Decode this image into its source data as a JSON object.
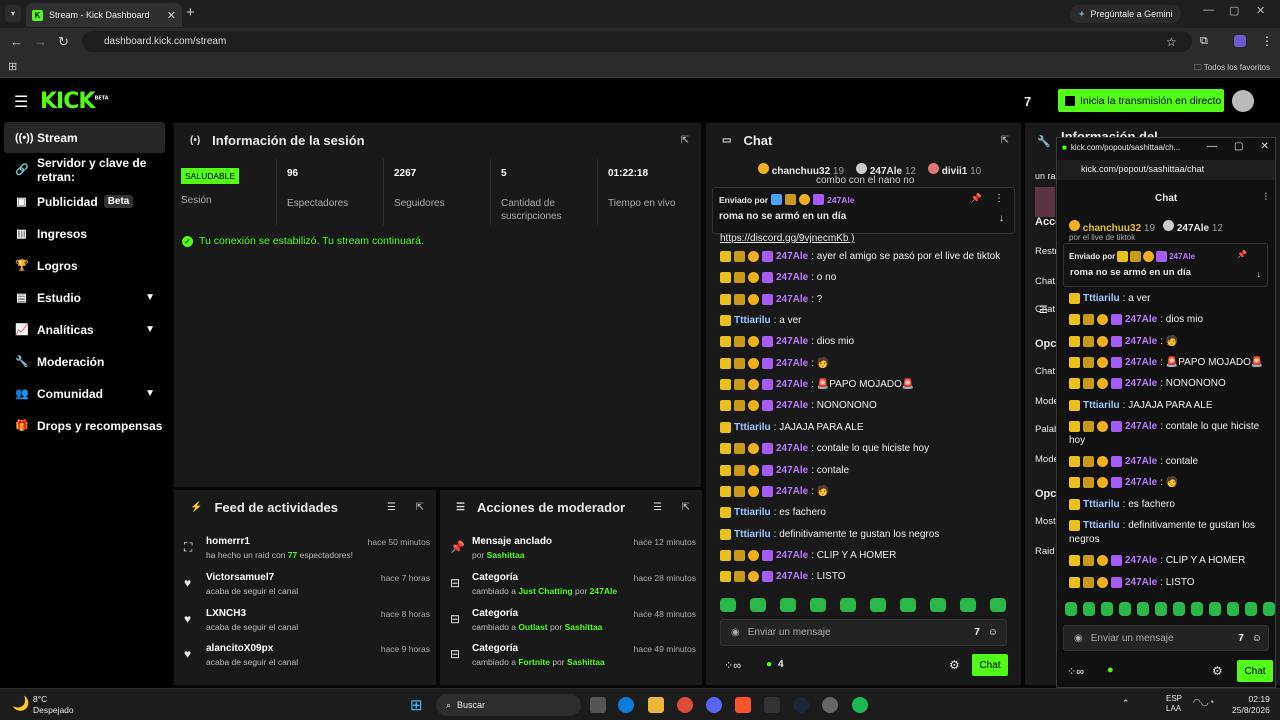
{
  "browser": {
    "tab_title": "Stream - Kick Dashboard",
    "url": "dashboard.kick.com/stream",
    "gemini": "Pregúntale a Gemini",
    "favorites": "Todos los favoritos"
  },
  "header": {
    "logo": "KICK",
    "logo_badge": "BETA",
    "go_live": "Inicia la transmisión en directo",
    "tv_icon": "7tv-icon"
  },
  "sidebar": {
    "items": [
      {
        "label": "Stream",
        "icon": "signal-icon"
      },
      {
        "label": "Servidor y clave de retran:",
        "icon": "link-icon"
      },
      {
        "label": "Publicidad",
        "badge": "Beta",
        "icon": "ad-icon"
      },
      {
        "label": "Ingresos",
        "icon": "chart-icon"
      },
      {
        "label": "Logros",
        "icon": "trophy-icon"
      },
      {
        "label": "Estudio",
        "icon": "studio-icon"
      },
      {
        "label": "Analíticas",
        "icon": "analytics-icon"
      },
      {
        "label": "Moderación",
        "icon": "wrench-icon"
      },
      {
        "label": "Comunidad",
        "icon": "community-icon"
      },
      {
        "label": "Drops y recompensas",
        "icon": "gift-icon"
      }
    ]
  },
  "session": {
    "title": "Información de la sesión",
    "health": "SALUDABLE",
    "health_label": "Sesión",
    "stats": [
      {
        "value": "96",
        "label": "Espectadores"
      },
      {
        "value": "2267",
        "label": "Seguidores"
      },
      {
        "value": "5",
        "label": "Cantidad de suscripciones"
      },
      {
        "value": "01:22:18",
        "label": "Tiempo en vivo"
      }
    ],
    "message": "Tu conexión se estabilizó. Tu stream continuará."
  },
  "feed": {
    "title": "Feed de actividades",
    "items": [
      {
        "name": "homerrr1",
        "pre": "ha hecho un raid con ",
        "count": "77",
        "post": " espectadores!",
        "time": "hace 50 minutos"
      },
      {
        "name": "Victorsamuel7",
        "sub": "acaba de seguir el canal",
        "time": "hace 7 horas"
      },
      {
        "name": "LXNCH3",
        "sub": "acaba de seguir el canal",
        "time": "hace 8 horas"
      },
      {
        "name": "alancitoX09px",
        "sub": "acaba de seguir el canal",
        "time": "hace 9 horas"
      }
    ]
  },
  "mod": {
    "title": "Acciones de moderador",
    "items": [
      {
        "name": "Mensaje anclado",
        "pre": "por ",
        "a": "Sashittaa",
        "mid": "",
        "b": "",
        "time": "hace 12 minutos"
      },
      {
        "name": "Categoría",
        "pre": "cambiado a ",
        "a": "Just Chatting",
        "mid": " por ",
        "b": "247Ale",
        "time": "hace 28 minutos"
      },
      {
        "name": "Categoría",
        "pre": "cambiado a ",
        "a": "Outlast",
        "mid": " por ",
        "b": "Sashittaa",
        "time": "hace 48 minutos"
      },
      {
        "name": "Categoría",
        "pre": "cambiado a ",
        "a": "Fortnite",
        "mid": " por ",
        "b": "Sashittaa",
        "time": "hace 49 minutos"
      }
    ]
  },
  "chat": {
    "title": "Chat",
    "top": [
      {
        "name": "chanchuu32",
        "count": "19"
      },
      {
        "name": "247Ale",
        "count": "12"
      },
      {
        "name": "divii1",
        "count": "10"
      }
    ],
    "partial_top": "combo con el nano no",
    "pinned_by": "Enviado por",
    "pinned_user": "247Ale",
    "pinned_msg": "roma no se armó en un día",
    "link": "https://discord.gg/9vjnecmKb )",
    "messages": [
      {
        "u": "247Ale",
        "t": ": ayer el amigo se pasó por el live de tiktok",
        "c": "p",
        "b": 4
      },
      {
        "u": "247Ale",
        "t": ": o no",
        "c": "p",
        "b": 4
      },
      {
        "u": "247Ale",
        "t": ": ?",
        "c": "p",
        "b": 4
      },
      {
        "u": "Tttiarilu",
        "t": ": a ver",
        "c": "b",
        "b": 1
      },
      {
        "u": "247Ale",
        "t": ": dios mio",
        "c": "p",
        "b": 4
      },
      {
        "u": "247Ale",
        "t": ": 🧑",
        "c": "p",
        "b": 4
      },
      {
        "u": "247Ale",
        "t": ": 🚨PAPO MOJADO🚨",
        "c": "p",
        "b": 4
      },
      {
        "u": "247Ale",
        "t": ": NONONONO",
        "c": "p",
        "b": 4
      },
      {
        "u": "Tttiarilu",
        "t": ": JAJAJA PARA ALE",
        "c": "b",
        "b": 1
      },
      {
        "u": "247Ale",
        "t": ": contale lo que hiciste hoy",
        "c": "p",
        "b": 4
      },
      {
        "u": "247Ale",
        "t": ": contale",
        "c": "p",
        "b": 4
      },
      {
        "u": "247Ale",
        "t": ": 🧑",
        "c": "p",
        "b": 4
      },
      {
        "u": "Tttiarilu",
        "t": ": es fachero",
        "c": "b",
        "b": 1
      },
      {
        "u": "Tttiarilu",
        "t": ": definitivamente te gustan los negros",
        "c": "b",
        "b": 1
      },
      {
        "u": "247Ale",
        "t": ": CLIP Y A HOMER",
        "c": "p",
        "b": 4
      },
      {
        "u": "247Ale",
        "t": ": LISTO",
        "c": "p",
        "b": 4
      }
    ],
    "input_placeholder": "Enviar un mensaje",
    "viewers": "4",
    "send": "Chat"
  },
  "right": {
    "title": "Información del",
    "partial_1": "un ra",
    "labels": [
      "Acce",
      "Restr",
      "Chat",
      "Chat",
      "Opc",
      "Chat",
      "Mode",
      "Palab",
      "Mode",
      "Opc",
      "Most",
      "Raid"
    ]
  },
  "popup": {
    "url": "kick.com/popout/sashittaa/ch...",
    "url2": "kick.com/popout/sashittaa/chat",
    "title": "Chat",
    "partial_top": "por el live de tiktok",
    "messages": [
      {
        "u": "Tttiarilu",
        "t": ": a ver",
        "c": "b",
        "b": 1
      },
      {
        "u": "247Ale",
        "t": ": dios mio",
        "c": "p",
        "b": 4
      },
      {
        "u": "247Ale",
        "t": ": 🧑",
        "c": "p",
        "b": 4
      },
      {
        "u": "247Ale",
        "t": ": 🚨PAPO MOJADO🚨",
        "c": "p",
        "b": 4
      },
      {
        "u": "247Ale",
        "t": ": NONONONO",
        "c": "p",
        "b": 4
      },
      {
        "u": "Tttiarilu",
        "t": ": JAJAJA PARA ALE",
        "c": "b",
        "b": 1
      },
      {
        "u": "247Ale",
        "t": ": contale lo que hiciste",
        "c": "p",
        "b": 4,
        "wrap": "hoy"
      },
      {
        "u": "247Ale",
        "t": ": contale",
        "c": "p",
        "b": 4
      },
      {
        "u": "247Ale",
        "t": ": 🧑",
        "c": "p",
        "b": 4
      },
      {
        "u": "Tttiarilu",
        "t": ": es fachero",
        "c": "b",
        "b": 1
      },
      {
        "u": "Tttiarilu",
        "t": ": definitivamente te gustan los",
        "c": "b",
        "b": 1,
        "wrap": "negros"
      },
      {
        "u": "247Ale",
        "t": ": CLIP Y A HOMER",
        "c": "p",
        "b": 4
      },
      {
        "u": "247Ale",
        "t": ": LISTO",
        "c": "p",
        "b": 4
      }
    ]
  },
  "taskbar": {
    "temp": "8°C",
    "weather": "Despejado",
    "search": "Buscar",
    "lang1": "ESP",
    "lang2": "LAA",
    "time": "02:19",
    "date": "25/8/2026"
  }
}
